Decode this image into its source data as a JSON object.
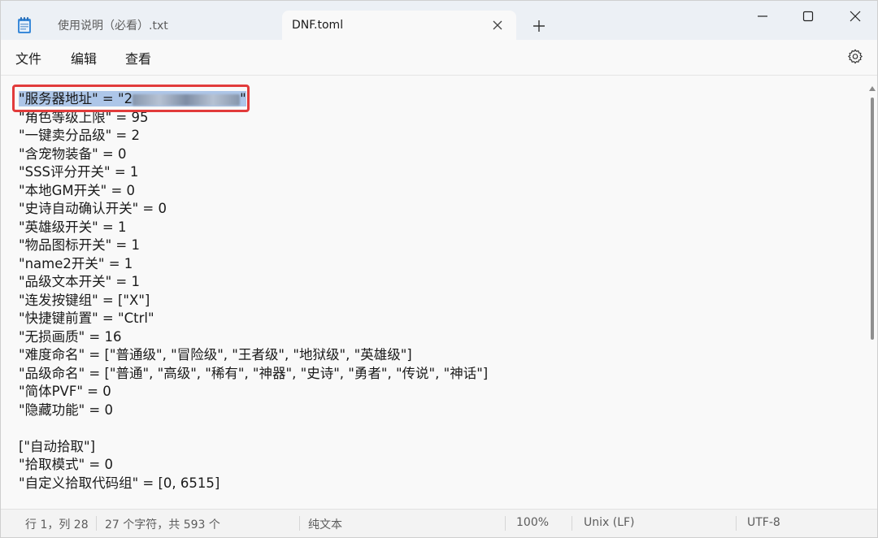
{
  "tabs": [
    {
      "label": "使用说明（必看）.txt",
      "active": false
    },
    {
      "label": "DNF.toml",
      "active": true
    }
  ],
  "menu": {
    "file": "文件",
    "edit": "编辑",
    "view": "查看"
  },
  "editor": {
    "first_line_prefix": "\"服务器地址\" = \"2",
    "first_line_suffix": "\"",
    "lines": [
      "\"角色等级上限\" = 95",
      "\"一键卖分品级\" = 2",
      "\"含宠物装备\" = 0",
      "\"SSS评分开关\" = 1",
      "\"本地GM开关\" = 0",
      "\"史诗自动确认开关\" = 0",
      "\"英雄级开关\" = 1",
      "\"物品图标开关\" = 1",
      "\"name2开关\" = 1",
      "\"品级文本开关\" = 1",
      "\"连发按键组\" = [\"X\"]",
      "\"快捷键前置\" = \"Ctrl\"",
      "\"无损画质\" = 16",
      "\"难度命名\" = [\"普通级\", \"冒险级\", \"王者级\", \"地狱级\", \"英雄级\"]",
      "\"品级命名\" = [\"普通\", \"高级\", \"稀有\", \"神器\", \"史诗\", \"勇者\", \"传说\", \"神话\"]",
      "\"简体PVF\" = 0",
      "\"隐藏功能\" = 0",
      "",
      "[\"自动拾取\"]",
      "\"拾取模式\" = 0",
      "\"自定义拾取代码组\" = [0, 6515]"
    ]
  },
  "status": {
    "position": "行 1，列 28",
    "count": "27 个字符，共 593 个",
    "type": "纯文本",
    "zoom": "100%",
    "eol": "Unix (LF)",
    "encoding": "UTF-8"
  },
  "colors": {
    "selection": "#adc6e8",
    "highlight": "#e23b3b",
    "titlebar": "#ecf0f5"
  }
}
